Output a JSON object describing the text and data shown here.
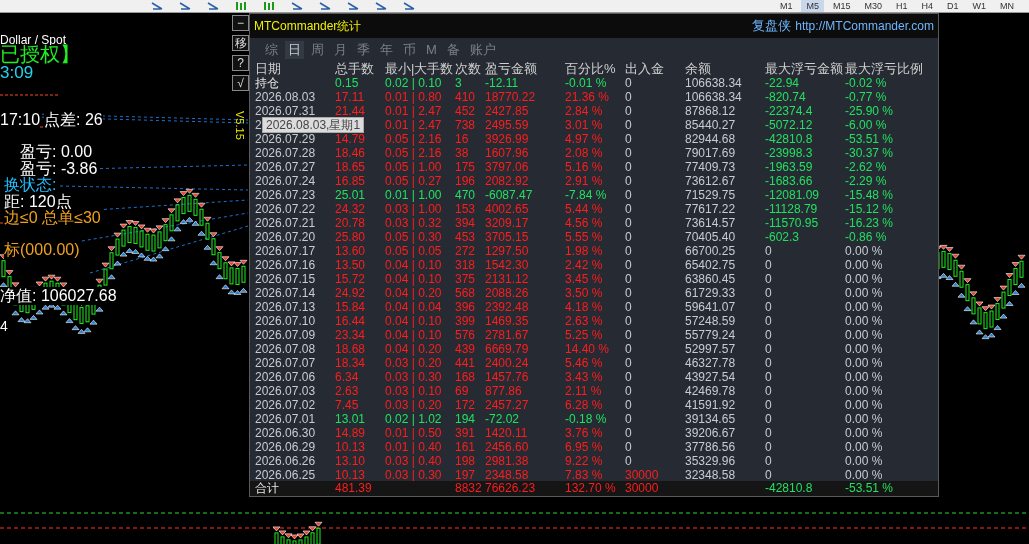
{
  "toolbar": {
    "timeframes": [
      {
        "label": "M1",
        "selected": false
      },
      {
        "label": "M5",
        "selected": true
      },
      {
        "label": "M15",
        "selected": false
      },
      {
        "label": "M30",
        "selected": false
      },
      {
        "label": "H1",
        "selected": false
      },
      {
        "label": "H4",
        "selected": false
      },
      {
        "label": "D1",
        "selected": false
      },
      {
        "label": "W1",
        "selected": false
      },
      {
        "label": "MN",
        "selected": false
      }
    ]
  },
  "chart": {
    "symbol": "Dollar / Spot",
    "license": "已授权】",
    "clock": "3:09",
    "spread_time": "17:10",
    "spread": "点差: 26",
    "pnl_lines": [
      "盈亏: 0.00",
      "盈亏: -3.86"
    ],
    "status": "换状态:",
    "grid_step": "距: 120点",
    "order_limits": "边≤0 总单≤30",
    "target": "标(000.00)",
    "equity": "净值: 106027.68",
    "digit": "4",
    "version": "V5.15"
  },
  "side_buttons": [
    "−",
    "移",
    "?",
    "√"
  ],
  "stats": {
    "title": "MTCommander统计",
    "brand": "复盘侠",
    "url": "http://MTCommander.com",
    "tabs": [
      {
        "label": "综",
        "selected": false
      },
      {
        "label": "日",
        "selected": true
      },
      {
        "label": "周",
        "selected": false
      },
      {
        "label": "月",
        "selected": false
      },
      {
        "label": "季",
        "selected": false
      },
      {
        "label": "年",
        "selected": false
      },
      {
        "label": "币",
        "selected": false
      },
      {
        "label": "M",
        "selected": false
      },
      {
        "label": "备",
        "selected": false
      },
      {
        "label": "账户",
        "selected": false
      }
    ],
    "columns": [
      "日期",
      "总手数",
      "最小|大手数",
      "次数",
      "盈亏金额",
      "百分比%",
      "出入金",
      "余额",
      "最大浮亏金额",
      "最大浮亏比例"
    ],
    "rows": [
      {
        "date": "持仓",
        "lots": "0.15",
        "min_max": "0.02 | 0.10",
        "count": "3",
        "pnl": "-12.11",
        "pct": "-0.01 %",
        "flow": "0",
        "balance": "106638.34",
        "max_dd": "-22.94",
        "max_dd_pct": "-0.02 %",
        "is_loss": true,
        "flow_marked": false,
        "dd_marked": true
      },
      {
        "date": "2026.08.03",
        "lots": "17.11",
        "min_max": "0.01 | 0.80",
        "count": "410",
        "pnl": "18770.22",
        "pct": "21.36 %",
        "flow": "0",
        "balance": "106638.34",
        "max_dd": "-820.74",
        "max_dd_pct": "-0.77 %",
        "is_loss": false,
        "flow_marked": false,
        "dd_marked": true
      },
      {
        "date": "2026.07.31",
        "lots": "21.44",
        "min_max": "0.01 | 2.47",
        "count": "452",
        "pnl": "2427.85",
        "pct": "2.84 %",
        "flow": "0",
        "balance": "87868.12",
        "max_dd": "-22374.4",
        "max_dd_pct": "-25.90 %",
        "is_loss": false,
        "flow_marked": false,
        "dd_marked": true
      },
      {
        "date": "2",
        "min_max": "0.01 | 2.47",
        "count": "738",
        "pnl": "2495.59",
        "pct": "3.01 %",
        "flow": "0",
        "balance": "85440.27",
        "max_dd": "-5072.12",
        "max_dd_pct": "-6.00 %",
        "is_loss": false,
        "flow_marked": false,
        "dd_marked": true
      },
      {
        "date": "2026.07.29",
        "lots": "14.79",
        "min_max": "0.05 | 2.16",
        "count": "16",
        "pnl": "3926.99",
        "pct": "4.97 %",
        "flow": "0",
        "balance": "82944.68",
        "max_dd": "-42810.8",
        "max_dd_pct": "-53.51 %",
        "is_loss": false,
        "flow_marked": false,
        "dd_marked": true
      },
      {
        "date": "2026.07.28",
        "lots": "18.46",
        "min_max": "0.05 | 2.16",
        "count": "38",
        "pnl": "1607.96",
        "pct": "2.08 %",
        "flow": "0",
        "balance": "79017.69",
        "max_dd": "-23998.3",
        "max_dd_pct": "-30.37 %",
        "is_loss": false,
        "flow_marked": false,
        "dd_marked": true
      },
      {
        "date": "2026.07.27",
        "lots": "18.65",
        "min_max": "0.05 | 1.00",
        "count": "175",
        "pnl": "3797.06",
        "pct": "5.16 %",
        "flow": "0",
        "balance": "77409.73",
        "max_dd": "-1963.59",
        "max_dd_pct": "-2.62 %",
        "is_loss": false,
        "flow_marked": false,
        "dd_marked": true
      },
      {
        "date": "2026.07.24",
        "lots": "16.85",
        "min_max": "0.05 | 0.27",
        "count": "196",
        "pnl": "2082.92",
        "pct": "2.91 %",
        "flow": "0",
        "balance": "73612.67",
        "max_dd": "-1683.66",
        "max_dd_pct": "-2.29 %",
        "is_loss": false,
        "flow_marked": false,
        "dd_marked": true
      },
      {
        "date": "2026.07.23",
        "lots": "25.01",
        "min_max": "0.01 | 1.00",
        "count": "470",
        "pnl": "-6087.47",
        "pct": "-7.84 %",
        "flow": "0",
        "balance": "71529.75",
        "max_dd": "-12081.09",
        "max_dd_pct": "-15.48 %",
        "is_loss": true,
        "flow_marked": false,
        "dd_marked": true
      },
      {
        "date": "2026.07.22",
        "lots": "24.32",
        "min_max": "0.03 | 1.00",
        "count": "153",
        "pnl": "4002.65",
        "pct": "5.44 %",
        "flow": "0",
        "balance": "77617.22",
        "max_dd": "-11128.79",
        "max_dd_pct": "-15.12 %",
        "is_loss": false,
        "flow_marked": false,
        "dd_marked": true
      },
      {
        "date": "2026.07.21",
        "lots": "20.78",
        "min_max": "0.03 | 0.32",
        "count": "394",
        "pnl": "3209.17",
        "pct": "4.56 %",
        "flow": "0",
        "balance": "73614.57",
        "max_dd": "-11570.95",
        "max_dd_pct": "-16.23 %",
        "is_loss": false,
        "flow_marked": false,
        "dd_marked": true
      },
      {
        "date": "2026.07.20",
        "lots": "25.80",
        "min_max": "0.05 | 0.30",
        "count": "453",
        "pnl": "3705.15",
        "pct": "5.55 %",
        "flow": "0",
        "balance": "70405.40",
        "max_dd": "-602.3",
        "max_dd_pct": "-0.86 %",
        "is_loss": false,
        "flow_marked": false,
        "dd_marked": true
      },
      {
        "date": "2026.07.17",
        "lots": "13.60",
        "min_max": "0.05 | 0.05",
        "count": "272",
        "pnl": "1297.50",
        "pct": "1.98 %",
        "flow": "0",
        "balance": "66700.25",
        "max_dd": "0",
        "max_dd_pct": "0.00 %",
        "is_loss": false,
        "flow_marked": false,
        "dd_marked": false
      },
      {
        "date": "2026.07.16",
        "lots": "13.50",
        "min_max": "0.04 | 0.10",
        "count": "318",
        "pnl": "1542.30",
        "pct": "2.42 %",
        "flow": "0",
        "balance": "65402.75",
        "max_dd": "0",
        "max_dd_pct": "0.00 %",
        "is_loss": false,
        "flow_marked": false,
        "dd_marked": false
      },
      {
        "date": "2026.07.15",
        "lots": "15.72",
        "min_max": "0.04 | 0.10",
        "count": "375",
        "pnl": "2131.12",
        "pct": "3.45 %",
        "flow": "0",
        "balance": "63860.45",
        "max_dd": "0",
        "max_dd_pct": "0.00 %",
        "is_loss": false,
        "flow_marked": false,
        "dd_marked": false
      },
      {
        "date": "2026.07.14",
        "lots": "24.92",
        "min_max": "0.04 | 0.20",
        "count": "568",
        "pnl": "2088.26",
        "pct": "3.50 %",
        "flow": "0",
        "balance": "61729.33",
        "max_dd": "0",
        "max_dd_pct": "0.00 %",
        "is_loss": false,
        "flow_marked": false,
        "dd_marked": false
      },
      {
        "date": "2026.07.13",
        "lots": "15.84",
        "min_max": "0.04 | 0.04",
        "count": "396",
        "pnl": "2392.48",
        "pct": "4.18 %",
        "flow": "0",
        "balance": "59641.07",
        "max_dd": "0",
        "max_dd_pct": "0.00 %",
        "is_loss": false,
        "flow_marked": false,
        "dd_marked": false
      },
      {
        "date": "2026.07.10",
        "lots": "16.44",
        "min_max": "0.04 | 0.10",
        "count": "399",
        "pnl": "1469.35",
        "pct": "2.63 %",
        "flow": "0",
        "balance": "57248.59",
        "max_dd": "0",
        "max_dd_pct": "0.00 %",
        "is_loss": false,
        "flow_marked": false,
        "dd_marked": false
      },
      {
        "date": "2026.07.09",
        "lots": "23.34",
        "min_max": "0.04 | 0.10",
        "count": "576",
        "pnl": "2781.67",
        "pct": "5.25 %",
        "flow": "0",
        "balance": "55779.24",
        "max_dd": "0",
        "max_dd_pct": "0.00 %",
        "is_loss": false,
        "flow_marked": false,
        "dd_marked": false
      },
      {
        "date": "2026.07.08",
        "lots": "18.68",
        "min_max": "0.04 | 0.20",
        "count": "439",
        "pnl": "6669.79",
        "pct": "14.40 %",
        "flow": "0",
        "balance": "52997.57",
        "max_dd": "0",
        "max_dd_pct": "0.00 %",
        "is_loss": false,
        "flow_marked": false,
        "dd_marked": false
      },
      {
        "date": "2026.07.07",
        "lots": "18.34",
        "min_max": "0.03 | 0.20",
        "count": "441",
        "pnl": "2400.24",
        "pct": "5.46 %",
        "flow": "0",
        "balance": "46327.78",
        "max_dd": "0",
        "max_dd_pct": "0.00 %",
        "is_loss": false,
        "flow_marked": false,
        "dd_marked": false
      },
      {
        "date": "2026.07.06",
        "lots": "6.34",
        "min_max": "0.03 | 0.30",
        "count": "168",
        "pnl": "1457.76",
        "pct": "3.43 %",
        "flow": "0",
        "balance": "43927.54",
        "max_dd": "0",
        "max_dd_pct": "0.00 %",
        "is_loss": false,
        "flow_marked": false,
        "dd_marked": false
      },
      {
        "date": "2026.07.03",
        "lots": "2.63",
        "min_max": "0.03 | 0.10",
        "count": "69",
        "pnl": "877.86",
        "pct": "2.11 %",
        "flow": "0",
        "balance": "42469.78",
        "max_dd": "0",
        "max_dd_pct": "0.00 %",
        "is_loss": false,
        "flow_marked": false,
        "dd_marked": false
      },
      {
        "date": "2026.07.02",
        "lots": "7.45",
        "min_max": "0.03 | 0.20",
        "count": "172",
        "pnl": "2457.27",
        "pct": "6.28 %",
        "flow": "0",
        "balance": "41591.92",
        "max_dd": "0",
        "max_dd_pct": "0.00 %",
        "is_loss": false,
        "flow_marked": false,
        "dd_marked": false
      },
      {
        "date": "2026.07.01",
        "lots": "13.01",
        "min_max": "0.02 | 1.02",
        "count": "194",
        "pnl": "-72.02",
        "pct": "-0.18 %",
        "flow": "0",
        "balance": "39134.65",
        "max_dd": "0",
        "max_dd_pct": "0.00 %",
        "is_loss": true,
        "flow_marked": false,
        "dd_marked": false
      },
      {
        "date": "2026.06.30",
        "lots": "14.89",
        "min_max": "0.01 | 0.50",
        "count": "391",
        "pnl": "1420.11",
        "pct": "3.76 %",
        "flow": "0",
        "balance": "39206.67",
        "max_dd": "0",
        "max_dd_pct": "0.00 %",
        "is_loss": false,
        "flow_marked": false,
        "dd_marked": false
      },
      {
        "date": "2026.06.29",
        "lots": "10.13",
        "min_max": "0.01 | 0.40",
        "count": "161",
        "pnl": "2456.60",
        "pct": "6.95 %",
        "flow": "0",
        "balance": "37786.56",
        "max_dd": "0",
        "max_dd_pct": "0.00 %",
        "is_loss": false,
        "flow_marked": false,
        "dd_marked": false
      },
      {
        "date": "2026.06.26",
        "lots": "13.10",
        "min_max": "0.03 | 0.40",
        "count": "198",
        "pnl": "2981.38",
        "pct": "9.22 %",
        "flow": "0",
        "balance": "35329.96",
        "max_dd": "0",
        "max_dd_pct": "0.00 %",
        "is_loss": false,
        "flow_marked": false,
        "dd_marked": false
      },
      {
        "date": "2026.06.25",
        "lots": "10.13",
        "min_max": "0.03 | 0.30",
        "count": "197",
        "pnl": "2348.58",
        "pct": "7.83 %",
        "flow": "30000",
        "balance": "32348.58",
        "max_dd": "0",
        "max_dd_pct": "0.00 %",
        "is_loss": false,
        "flow_marked": true,
        "dd_marked": false
      }
    ],
    "total": {
      "date": "合计",
      "lots": "481.39",
      "count": "8832",
      "pnl": "76626.23",
      "pct": "132.70 %",
      "flow": "30000",
      "max_dd": "-42810.8",
      "max_dd_pct": "-53.51 %",
      "is_loss": false,
      "flow_marked": true,
      "dd_marked": true
    },
    "tooltip": "2026.08.03,星期1"
  }
}
